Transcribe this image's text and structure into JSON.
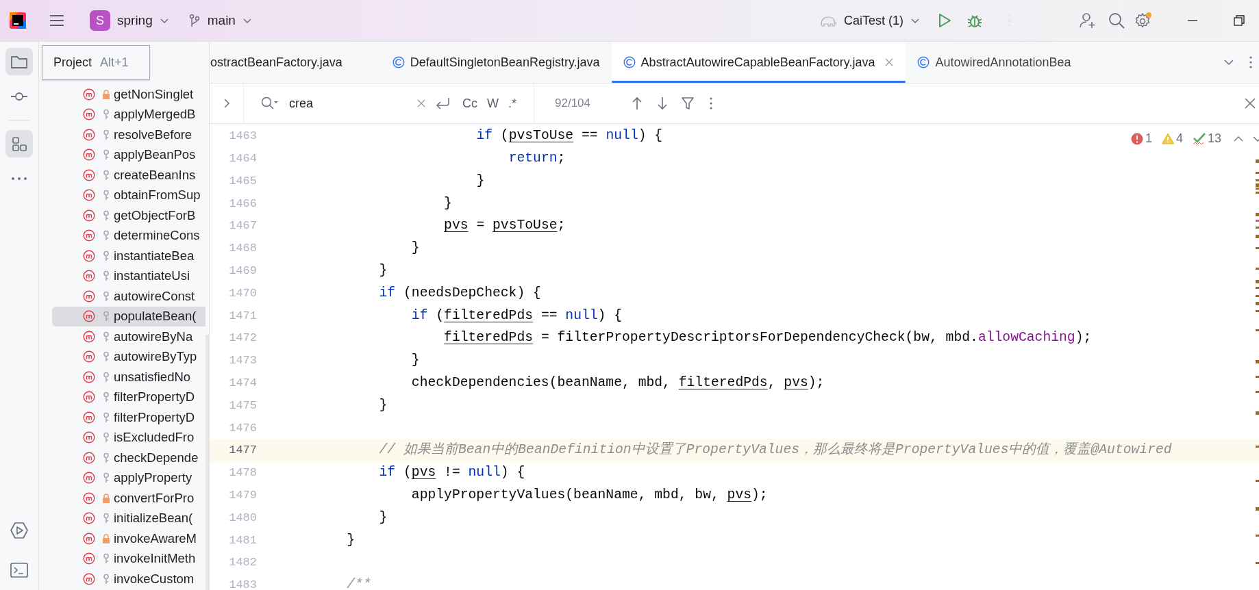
{
  "title_bar": {
    "project_badge": "S",
    "project": "spring",
    "branch": "main",
    "run_config": "CaiTest (1)"
  },
  "left_toolbar": {
    "top": [
      {
        "kind": "project",
        "selected": true
      },
      {
        "kind": "commit",
        "selected": false
      },
      {
        "kind": "structure",
        "selected": true
      },
      {
        "kind": "more",
        "selected": false
      }
    ],
    "bottom": [
      {
        "kind": "run",
        "selected": false
      },
      {
        "kind": "terminal",
        "selected": false
      }
    ]
  },
  "tooltip": {
    "title": "Project",
    "shortcut": "Alt+1"
  },
  "structure": [
    {
      "name": "getNonSinglet",
      "kind": "private",
      "selected": false
    },
    {
      "name": "applyMergedB",
      "kind": "protected",
      "selected": false
    },
    {
      "name": "resolveBefore",
      "kind": "protected",
      "selected": false
    },
    {
      "name": "applyBeanPos",
      "kind": "protected",
      "selected": false
    },
    {
      "name": "createBeanIns",
      "kind": "protected",
      "selected": false
    },
    {
      "name": "obtainFromSup",
      "kind": "protected",
      "selected": false
    },
    {
      "name": "getObjectForB",
      "kind": "protected",
      "selected": false
    },
    {
      "name": "determineCons",
      "kind": "protected",
      "selected": false
    },
    {
      "name": "instantiateBea",
      "kind": "protected",
      "selected": false
    },
    {
      "name": "instantiateUsi",
      "kind": "protected",
      "selected": false
    },
    {
      "name": "autowireConst",
      "kind": "protected",
      "selected": false
    },
    {
      "name": "populateBean(",
      "kind": "protected",
      "selected": true
    },
    {
      "name": "autowireByNa",
      "kind": "protected",
      "selected": false
    },
    {
      "name": "autowireByTyp",
      "kind": "protected",
      "selected": false
    },
    {
      "name": "unsatisfiedNo",
      "kind": "protected",
      "selected": false
    },
    {
      "name": "filterPropertyD",
      "kind": "protected",
      "selected": false
    },
    {
      "name": "filterPropertyD",
      "kind": "protected",
      "selected": false
    },
    {
      "name": "isExcludedFro",
      "kind": "protected",
      "selected": false
    },
    {
      "name": "checkDepende",
      "kind": "protected",
      "selected": false
    },
    {
      "name": "applyProperty",
      "kind": "protected",
      "selected": false
    },
    {
      "name": "convertForPro",
      "kind": "private",
      "selected": false
    },
    {
      "name": "initializeBean(",
      "kind": "protected",
      "selected": false
    },
    {
      "name": "invokeAwareM",
      "kind": "private",
      "selected": false
    },
    {
      "name": "invokeInitMeth",
      "kind": "protected",
      "selected": false
    },
    {
      "name": "invokeCustom",
      "kind": "protected",
      "selected": false
    }
  ],
  "tabs": [
    {
      "label": "ostractBeanFactory.java",
      "class_icon": false,
      "selected": false
    },
    {
      "label": "DefaultSingletonBeanRegistry.java",
      "class_icon": true,
      "selected": false
    },
    {
      "label": "AbstractAutowireCapableBeanFactory.java",
      "class_icon": true,
      "selected": true
    },
    {
      "label": "AutowiredAnnotationBea",
      "class_icon": true,
      "selected": false
    }
  ],
  "find_bar": {
    "query": "crea",
    "options": [
      "Cc",
      "W",
      ".*"
    ],
    "match_count": "92/104"
  },
  "inspections": {
    "errors": "1",
    "warnings": "4",
    "typos": "13"
  },
  "code": {
    "lines": [
      {
        "number": "1463",
        "current": false,
        "tokens": [
          {
            "kind": "keyword",
            "text": "                    if"
          },
          {
            "kind": "plain",
            "text": " ("
          },
          {
            "kind": "variable",
            "text": "pvsToUse"
          },
          {
            "kind": "plain",
            "text": " == "
          },
          {
            "kind": "keyword",
            "text": "null"
          },
          {
            "kind": "plain",
            "text": ") {"
          }
        ]
      },
      {
        "number": "1464",
        "current": false,
        "tokens": [
          {
            "kind": "keyword",
            "text": "                        return"
          },
          {
            "kind": "plain",
            "text": ";"
          }
        ]
      },
      {
        "number": "1465",
        "current": false,
        "tokens": [
          {
            "kind": "plain",
            "text": "                    }"
          }
        ]
      },
      {
        "number": "1466",
        "current": false,
        "tokens": [
          {
            "kind": "plain",
            "text": "                }"
          }
        ]
      },
      {
        "number": "1467",
        "current": false,
        "tokens": [
          {
            "kind": "variable",
            "text": "                pvs"
          },
          {
            "kind": "plain",
            "text": " = "
          },
          {
            "kind": "variable",
            "text": "pvsToUse"
          },
          {
            "kind": "plain",
            "text": ";"
          }
        ]
      },
      {
        "number": "1468",
        "current": false,
        "tokens": [
          {
            "kind": "plain",
            "text": "            }"
          }
        ]
      },
      {
        "number": "1469",
        "current": false,
        "tokens": [
          {
            "kind": "plain",
            "text": "        }"
          }
        ]
      },
      {
        "number": "1470",
        "current": false,
        "tokens": [
          {
            "kind": "keyword",
            "text": "        if"
          },
          {
            "kind": "plain",
            "text": " (needsDepCheck) {"
          }
        ]
      },
      {
        "number": "1471",
        "current": false,
        "tokens": [
          {
            "kind": "keyword",
            "text": "            if"
          },
          {
            "kind": "plain",
            "text": " ("
          },
          {
            "kind": "variable",
            "text": "filteredPds"
          },
          {
            "kind": "plain",
            "text": " == "
          },
          {
            "kind": "keyword",
            "text": "null"
          },
          {
            "kind": "plain",
            "text": ") {"
          }
        ]
      },
      {
        "number": "1472",
        "current": false,
        "tokens": [
          {
            "kind": "variable",
            "text": "                filteredPds"
          },
          {
            "kind": "plain",
            "text": " = filterPropertyDescriptorsForDependencyCheck(bw, mbd."
          },
          {
            "kind": "field",
            "text": "allowCaching"
          },
          {
            "kind": "plain",
            "text": ");"
          }
        ]
      },
      {
        "number": "1473",
        "current": false,
        "tokens": [
          {
            "kind": "plain",
            "text": "            }"
          }
        ]
      },
      {
        "number": "1474",
        "current": false,
        "tokens": [
          {
            "kind": "plain",
            "text": "            checkDependencies(beanName, mbd, "
          },
          {
            "kind": "variable",
            "text": "filteredPds"
          },
          {
            "kind": "plain",
            "text": ", "
          },
          {
            "kind": "variable",
            "text": "pvs"
          },
          {
            "kind": "plain",
            "text": ");"
          }
        ]
      },
      {
        "number": "1475",
        "current": false,
        "tokens": [
          {
            "kind": "plain",
            "text": "        }"
          }
        ]
      },
      {
        "number": "1476",
        "current": false
      },
      {
        "number": "1477",
        "current": true,
        "tokens": [
          {
            "kind": "comment",
            "text": "        // 如果当前Bean中的BeanDefinition中设置了PropertyValues，那么最终将是PropertyValues中的值，覆盖@Autowired"
          }
        ]
      },
      {
        "number": "1478",
        "current": false,
        "tokens": [
          {
            "kind": "keyword",
            "text": "        if"
          },
          {
            "kind": "plain",
            "text": " ("
          },
          {
            "kind": "variable",
            "text": "pvs"
          },
          {
            "kind": "plain",
            "text": " != "
          },
          {
            "kind": "keyword",
            "text": "null"
          },
          {
            "kind": "plain",
            "text": ") {"
          }
        ]
      },
      {
        "number": "1479",
        "current": false,
        "tokens": [
          {
            "kind": "plain",
            "text": "            applyPropertyValues(beanName, mbd, bw, "
          },
          {
            "kind": "variable",
            "text": "pvs"
          },
          {
            "kind": "plain",
            "text": ");"
          }
        ]
      },
      {
        "number": "1480",
        "current": false,
        "tokens": [
          {
            "kind": "plain",
            "text": "        }"
          }
        ]
      },
      {
        "number": "1481",
        "current": false,
        "tokens": [
          {
            "kind": "plain",
            "text": "    }"
          }
        ]
      },
      {
        "number": "1482",
        "current": false
      },
      {
        "number": "1483",
        "current": false,
        "tokens": [
          {
            "kind": "comment",
            "text": "    /**"
          }
        ]
      }
    ]
  }
}
